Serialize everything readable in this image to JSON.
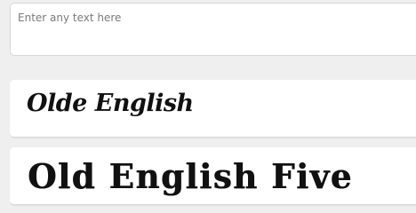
{
  "input": {
    "placeholder": "Enter any text here",
    "value": ""
  },
  "previews": [
    {
      "text": "Olde English"
    },
    {
      "text": "Old English Five"
    }
  ]
}
